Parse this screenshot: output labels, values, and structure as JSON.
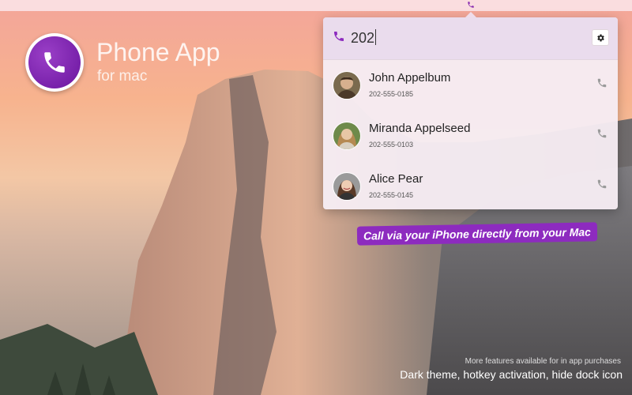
{
  "app": {
    "title": "Phone App",
    "subtitle": "for mac"
  },
  "search": {
    "value": "202",
    "placeholder": ""
  },
  "contacts": [
    {
      "name": "John Appelbum",
      "number": "202-555-0185"
    },
    {
      "name": "Miranda Appelseed",
      "number": "202-555-0103"
    },
    {
      "name": "Alice Pear",
      "number": "202-555-0145"
    }
  ],
  "promo": {
    "tagline": "Call via your iPhone directly from your Mac",
    "more": "More features available for in app purchases",
    "features": "Dark theme, hotkey activation, hide dock icon"
  },
  "colors": {
    "accent": "#8d2bbf",
    "icon_gray": "#9a9a9a"
  },
  "icons": {
    "menubar": "phone-icon",
    "search": "phone-icon",
    "settings": "gear-icon",
    "call": "phone-icon"
  }
}
